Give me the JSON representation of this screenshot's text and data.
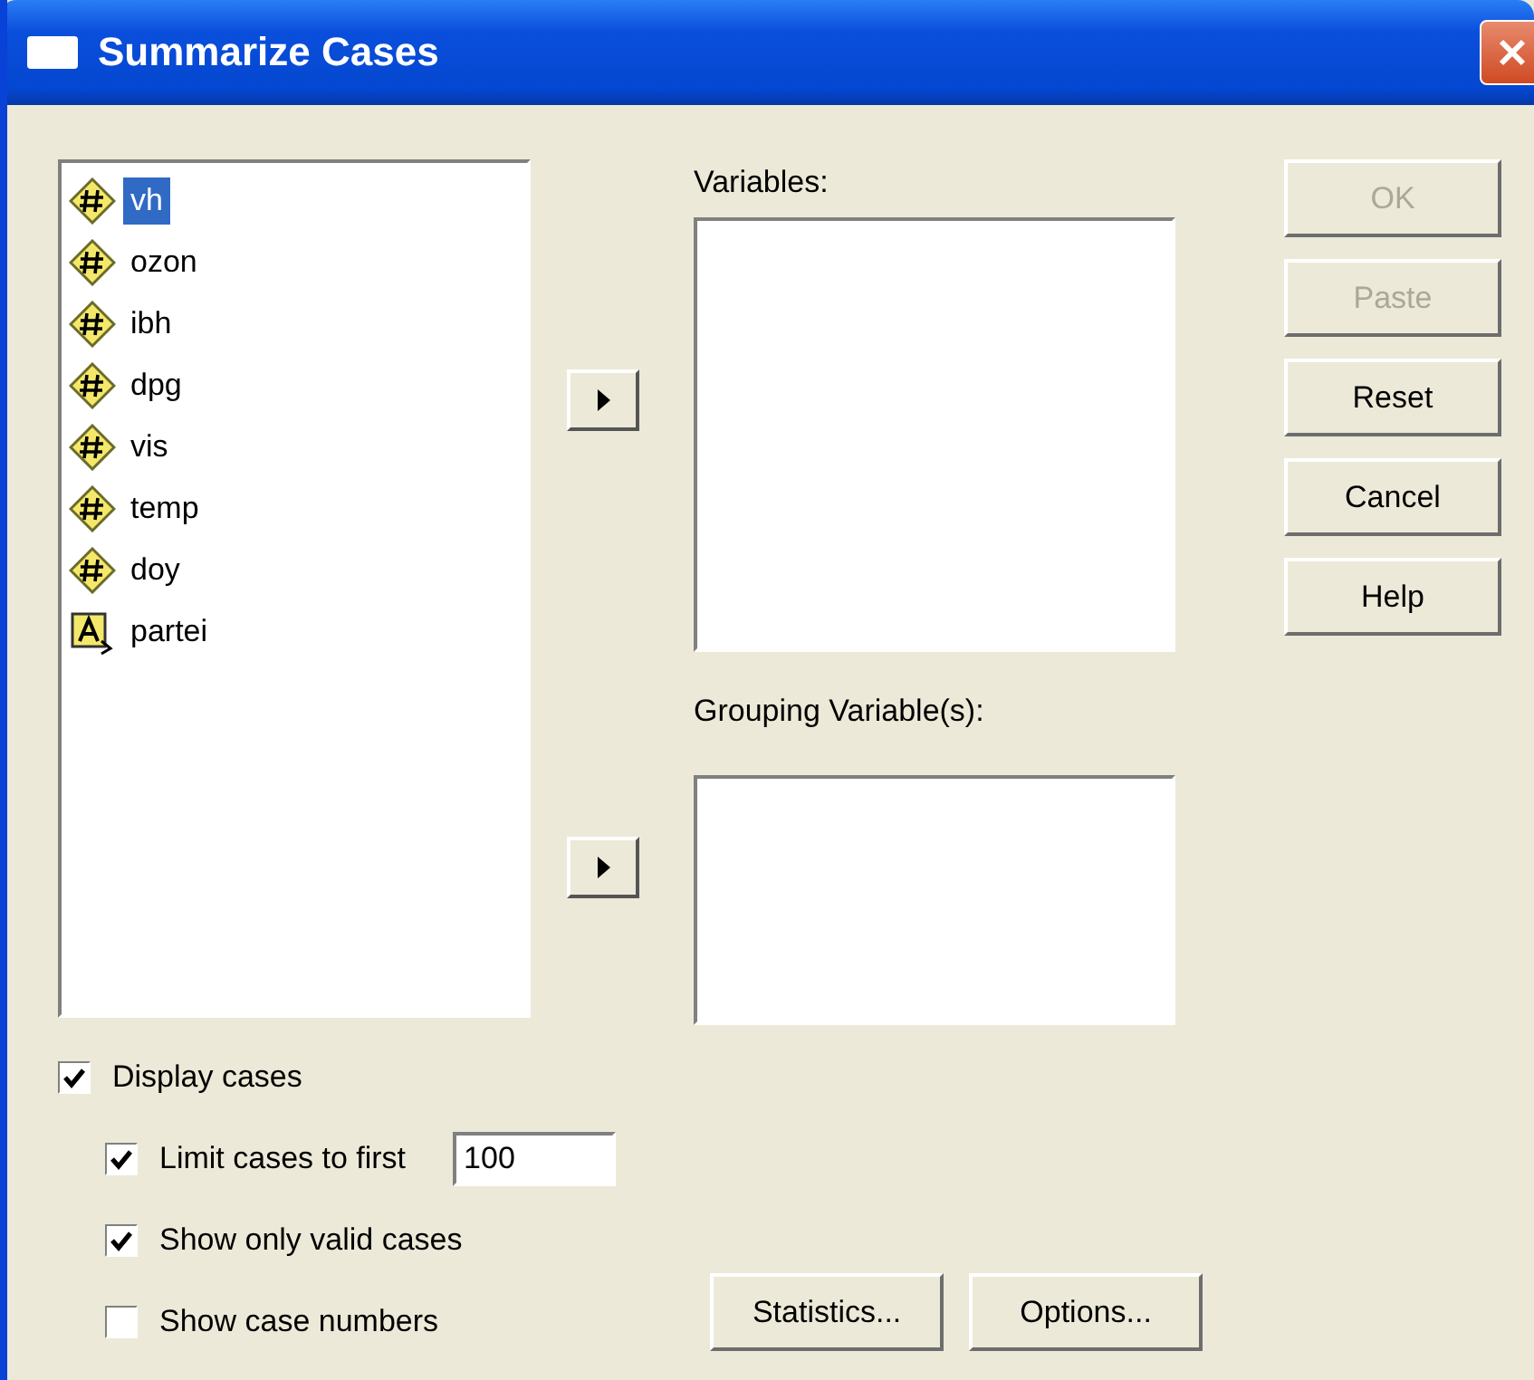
{
  "window": {
    "title": "Summarize Cases"
  },
  "source_list": [
    {
      "name": "vh",
      "kind": "numeric",
      "selected": true
    },
    {
      "name": "ozon",
      "kind": "numeric",
      "selected": false
    },
    {
      "name": "ibh",
      "kind": "numeric",
      "selected": false
    },
    {
      "name": "dpg",
      "kind": "numeric",
      "selected": false
    },
    {
      "name": "vis",
      "kind": "numeric",
      "selected": false
    },
    {
      "name": "temp",
      "kind": "numeric",
      "selected": false
    },
    {
      "name": "doy",
      "kind": "numeric",
      "selected": false
    },
    {
      "name": "partei",
      "kind": "string",
      "selected": false
    }
  ],
  "variables": {
    "label": "Variables:"
  },
  "grouping": {
    "label": "Grouping Variable(s):"
  },
  "buttons": [
    {
      "label": "OK",
      "disabled": true
    },
    {
      "label": "Paste",
      "disabled": true
    },
    {
      "label": "Reset",
      "disabled": false
    },
    {
      "label": "Cancel",
      "disabled": false
    },
    {
      "label": "Help",
      "disabled": false
    }
  ],
  "display_cases": {
    "label": "Display cases",
    "checked": true,
    "children": [
      {
        "label": "Limit cases to first",
        "checked": true,
        "value": "100"
      },
      {
        "label": "Show only valid cases",
        "checked": true
      },
      {
        "label": "Show case numbers",
        "checked": false
      }
    ]
  },
  "bottom_buttons": [
    "Statistics...",
    "Options..."
  ]
}
